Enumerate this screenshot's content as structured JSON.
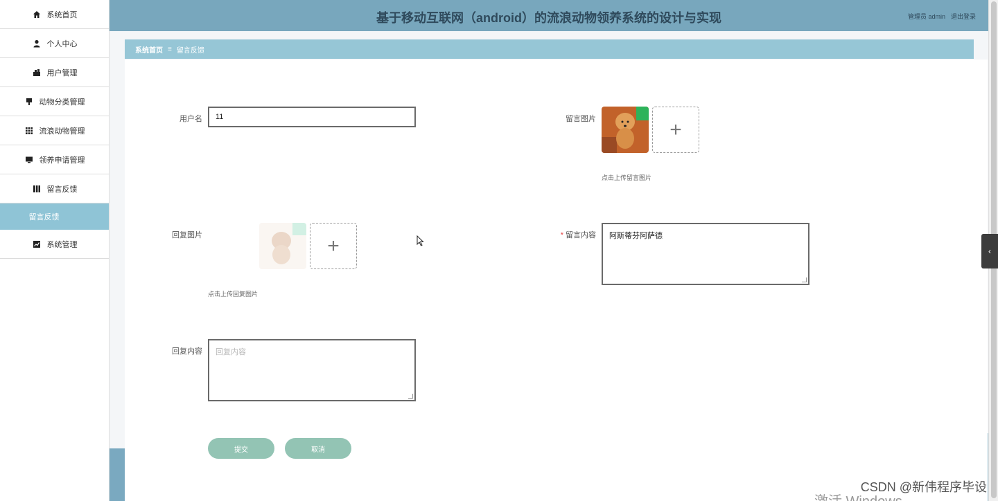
{
  "header": {
    "title": "基于移动互联网（android）的流浪动物领养系统的设计与实现",
    "admin_label": "管理员 admin",
    "logout_label": "退出登录"
  },
  "sidebar": {
    "items": [
      {
        "label": "系统首页",
        "icon": "home-icon"
      },
      {
        "label": "个人中心",
        "icon": "user-icon"
      },
      {
        "label": "用户管理",
        "icon": "users-icon"
      },
      {
        "label": "动物分类管理",
        "icon": "category-icon"
      },
      {
        "label": "流浪动物管理",
        "icon": "grid-icon"
      },
      {
        "label": "领养申请管理",
        "icon": "monitor-icon"
      },
      {
        "label": "留言反馈",
        "icon": "book-icon"
      }
    ],
    "active_sub": "留言反馈",
    "last_item": {
      "label": "系统管理",
      "icon": "chart-icon"
    }
  },
  "breadcrumb": {
    "home": "系统首页",
    "separator": "≡",
    "current": "留言反馈"
  },
  "form": {
    "username_label": "用户名",
    "username_value": "11",
    "message_image_label": "留言图片",
    "message_image_hint": "点击上传留言图片",
    "reply_image_label": "回复图片",
    "reply_image_hint": "点击上传回复图片",
    "message_content_label": "留言内容",
    "message_content_value": "阿斯蒂芬阿萨德",
    "reply_content_label": "回复内容",
    "reply_content_placeholder": "回复内容",
    "submit_label": "提交",
    "cancel_label": "取消"
  },
  "overlay": {
    "watermark": "CSDN @新伟程序毕设",
    "windows_text": "激活 Windows"
  },
  "colors": {
    "header_bg": "#78a7bd",
    "breadcrumb_bg": "#96c6d6",
    "active_sub_bg": "#8fc4d6",
    "button_bg": "#93c4b4"
  }
}
